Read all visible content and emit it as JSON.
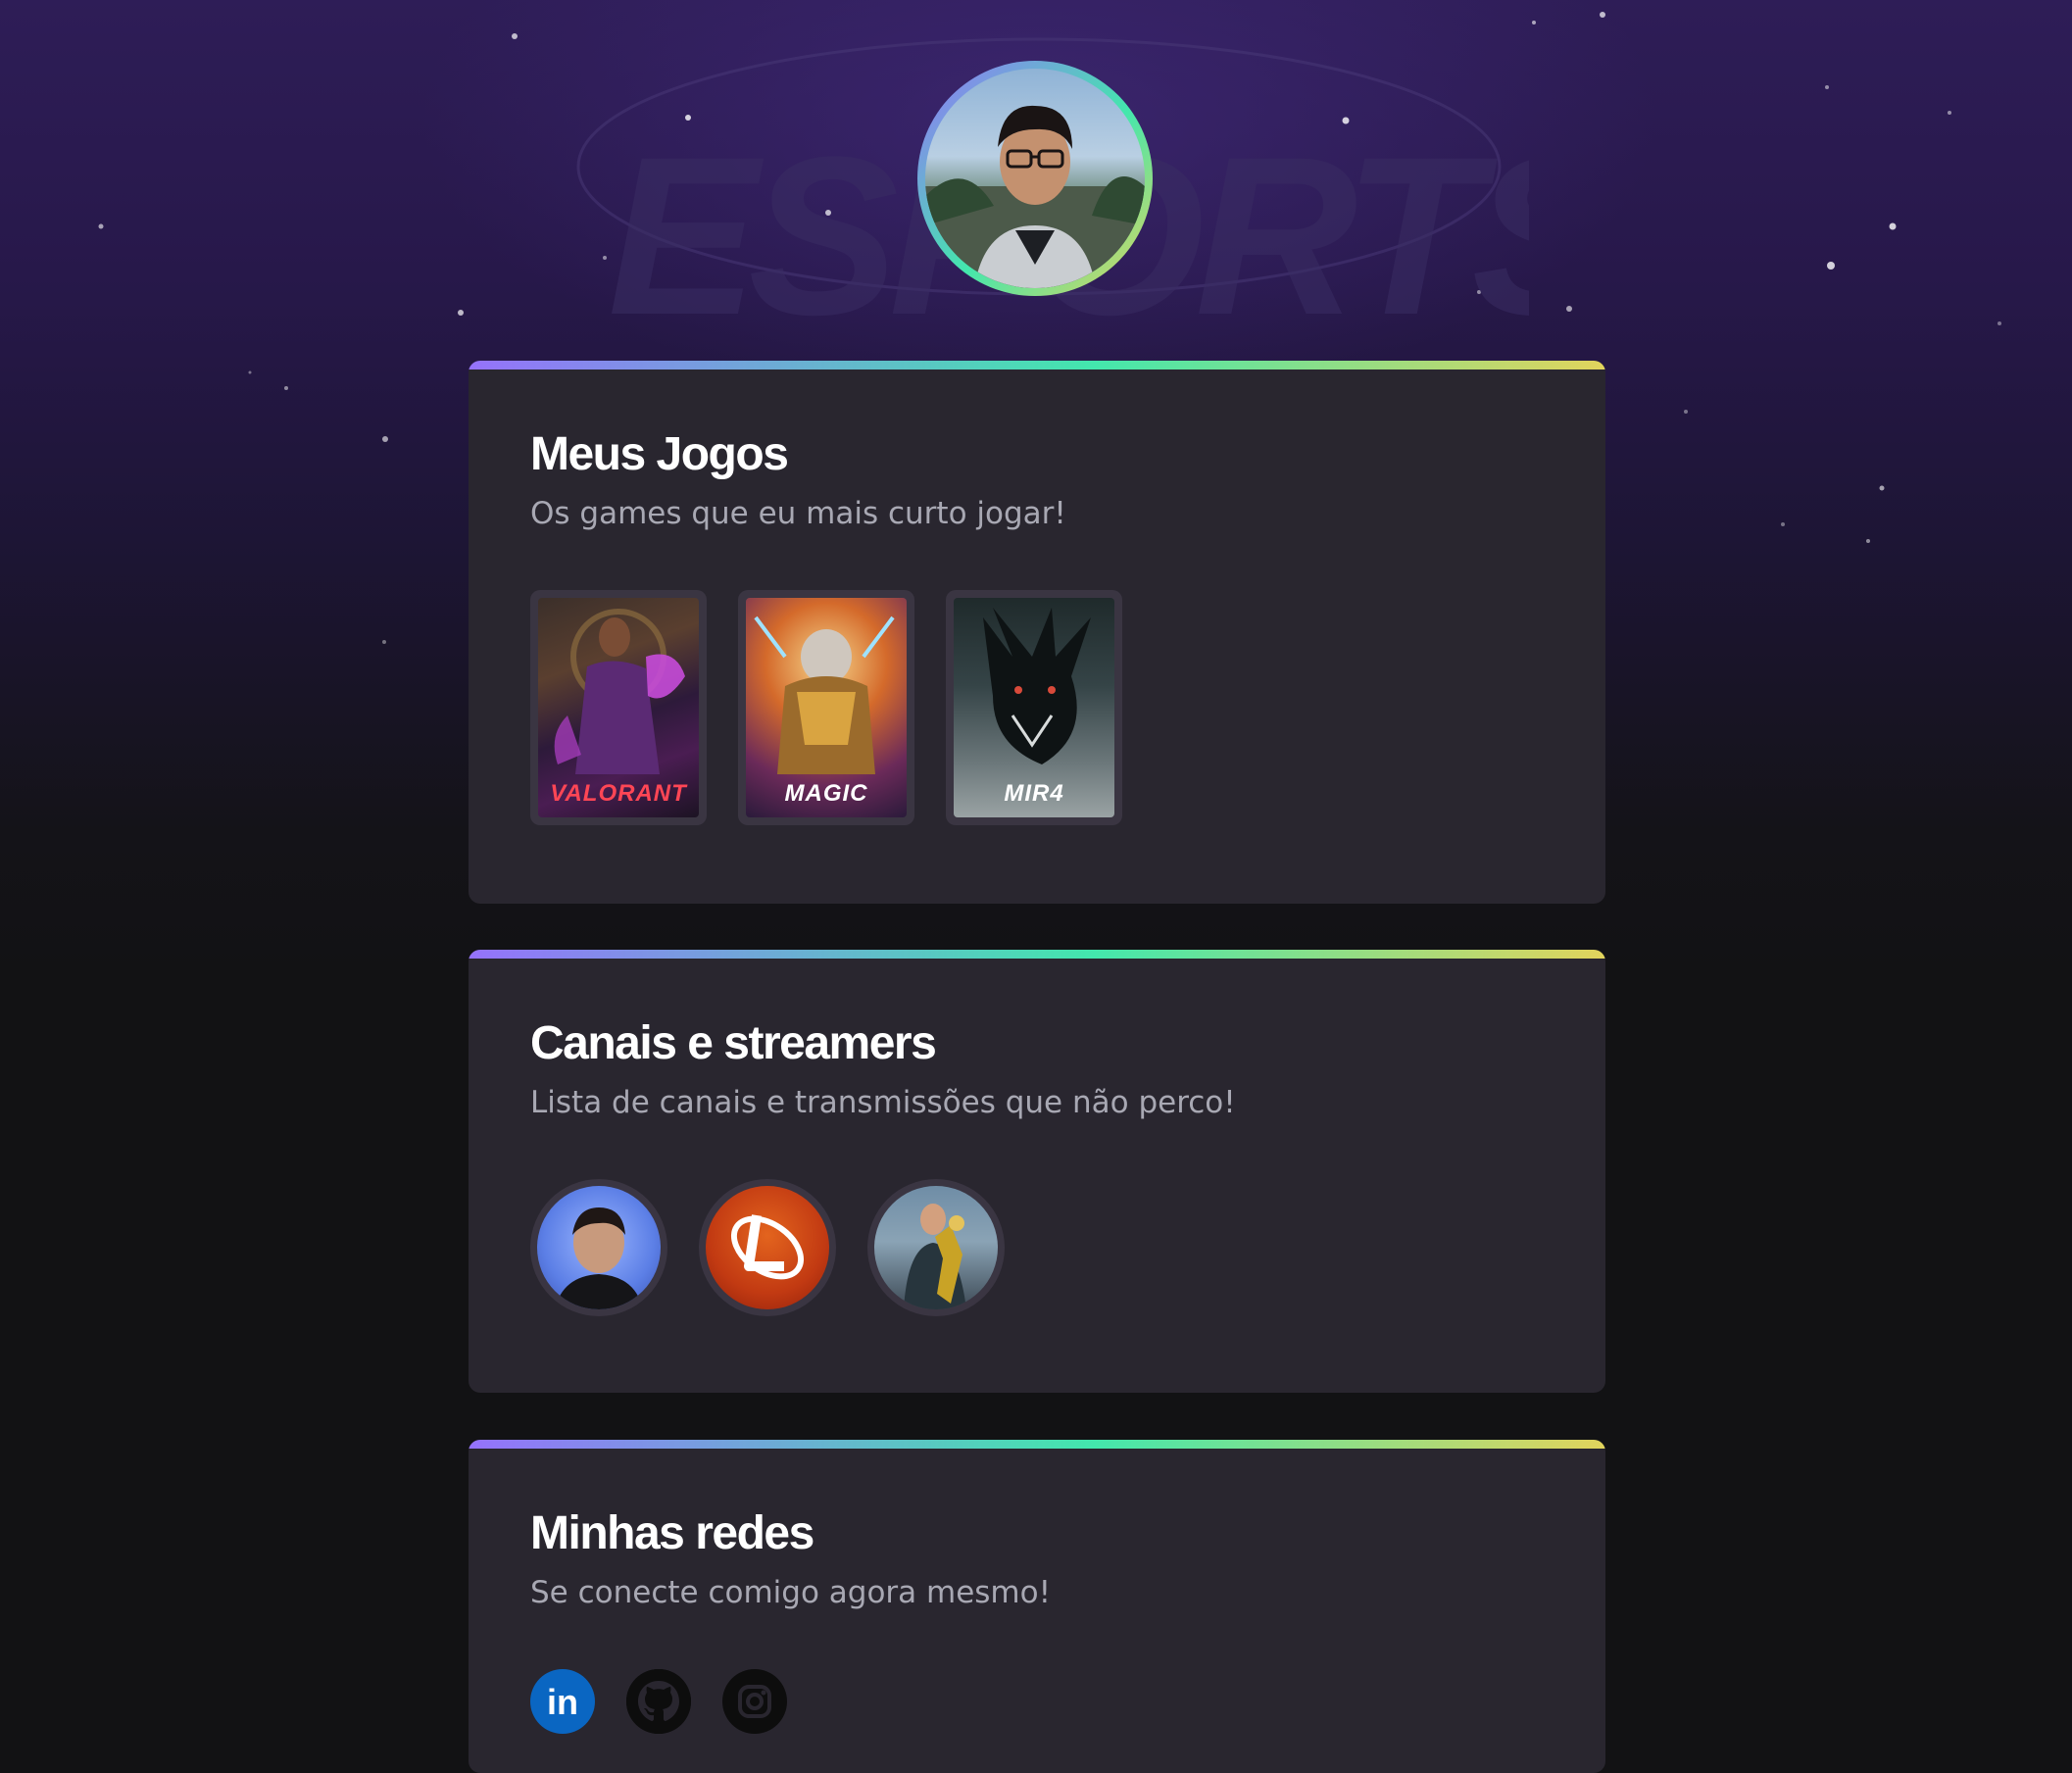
{
  "profile": {
    "avatar_icon": "profile-photo"
  },
  "games_card": {
    "title": "Meus Jogos",
    "subtitle": "Os games que eu mais curto jogar!",
    "games": [
      {
        "name": "VALORANT",
        "icon": "valorant-cover"
      },
      {
        "name": "MAGIC",
        "icon": "magic-the-gathering-cover"
      },
      {
        "name": "MIR4",
        "icon": "mir4-cover"
      }
    ]
  },
  "streamers_card": {
    "title": "Canais e streamers",
    "subtitle": "Lista de canais e transmissões que não perco!",
    "streamers": [
      {
        "icon": "streamer-avatar-1"
      },
      {
        "icon": "streamer-avatar-2-logo"
      },
      {
        "icon": "streamer-avatar-3"
      }
    ]
  },
  "socials_card": {
    "title": "Minhas redes",
    "subtitle": "Se conecte comigo agora mesmo!",
    "socials": [
      {
        "icon": "linkedin-icon",
        "color": "#0a66c2"
      },
      {
        "icon": "github-icon",
        "color": "#0d0d0d"
      },
      {
        "icon": "instagram-icon",
        "color": "#0d0d0d"
      }
    ]
  },
  "colors": {
    "accent_gradient": [
      "#9572fc",
      "#43e7ad",
      "#e2d45c"
    ],
    "card_background": "#29262f",
    "page_background": "#121214",
    "title_color": "#ffffff",
    "subtitle_color": "#a8a8b3"
  }
}
